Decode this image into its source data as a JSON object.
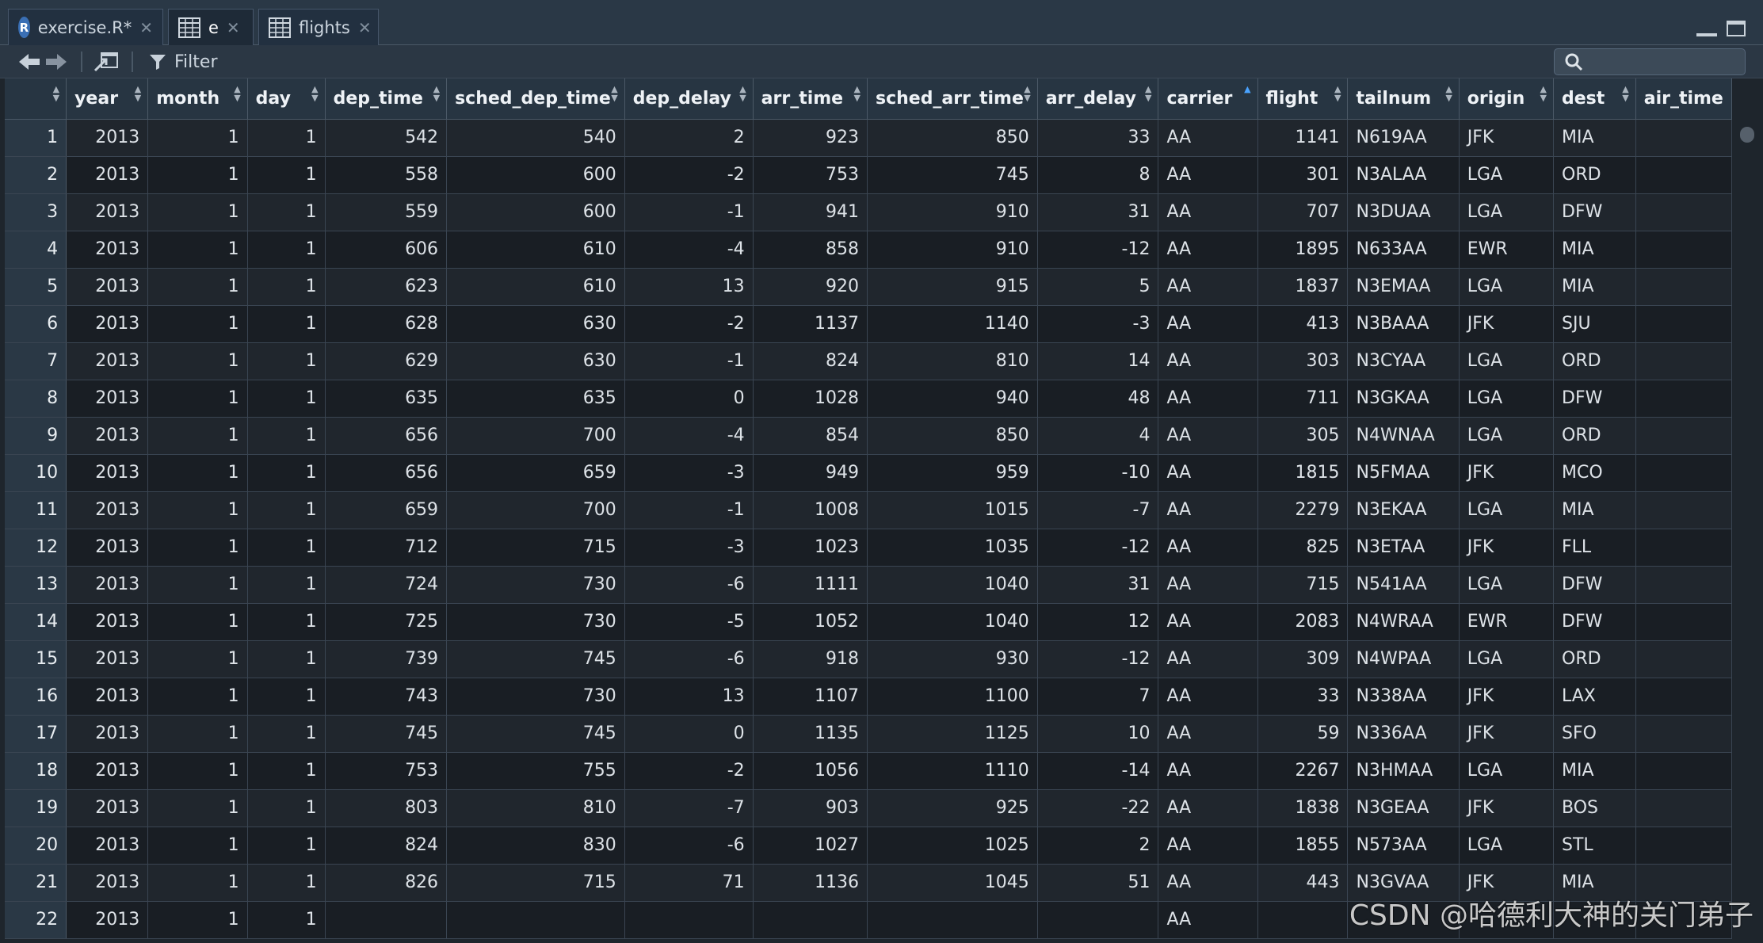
{
  "tabs": [
    {
      "label": "exercise.R*",
      "icon": "r-file-icon",
      "active": false
    },
    {
      "label": "e",
      "icon": "data-grid-icon",
      "active": true
    },
    {
      "label": "flights",
      "icon": "data-grid-icon",
      "active": false
    }
  ],
  "toolbar": {
    "filter_label": "Filter",
    "search_placeholder": ""
  },
  "columns": [
    {
      "label": "",
      "sort": "none"
    },
    {
      "label": "year",
      "sort": "none"
    },
    {
      "label": "month",
      "sort": "none"
    },
    {
      "label": "day",
      "sort": "none"
    },
    {
      "label": "dep_time",
      "sort": "none"
    },
    {
      "label": "sched_dep_time",
      "sort": "none"
    },
    {
      "label": "dep_delay",
      "sort": "none"
    },
    {
      "label": "arr_time",
      "sort": "none"
    },
    {
      "label": "sched_arr_time",
      "sort": "none"
    },
    {
      "label": "arr_delay",
      "sort": "none"
    },
    {
      "label": "carrier",
      "sort": "asc"
    },
    {
      "label": "flight",
      "sort": "none"
    },
    {
      "label": "tailnum",
      "sort": "none"
    },
    {
      "label": "origin",
      "sort": "none"
    },
    {
      "label": "dest",
      "sort": "none"
    },
    {
      "label": "air_time",
      "sort": "none"
    }
  ],
  "rows": [
    [
      "1",
      "2013",
      "1",
      "1",
      "542",
      "540",
      "2",
      "923",
      "850",
      "33",
      "AA",
      "1141",
      "N619AA",
      "JFK",
      "MIA",
      ""
    ],
    [
      "2",
      "2013",
      "1",
      "1",
      "558",
      "600",
      "-2",
      "753",
      "745",
      "8",
      "AA",
      "301",
      "N3ALAA",
      "LGA",
      "ORD",
      ""
    ],
    [
      "3",
      "2013",
      "1",
      "1",
      "559",
      "600",
      "-1",
      "941",
      "910",
      "31",
      "AA",
      "707",
      "N3DUAA",
      "LGA",
      "DFW",
      ""
    ],
    [
      "4",
      "2013",
      "1",
      "1",
      "606",
      "610",
      "-4",
      "858",
      "910",
      "-12",
      "AA",
      "1895",
      "N633AA",
      "EWR",
      "MIA",
      ""
    ],
    [
      "5",
      "2013",
      "1",
      "1",
      "623",
      "610",
      "13",
      "920",
      "915",
      "5",
      "AA",
      "1837",
      "N3EMAA",
      "LGA",
      "MIA",
      ""
    ],
    [
      "6",
      "2013",
      "1",
      "1",
      "628",
      "630",
      "-2",
      "1137",
      "1140",
      "-3",
      "AA",
      "413",
      "N3BAAA",
      "JFK",
      "SJU",
      ""
    ],
    [
      "7",
      "2013",
      "1",
      "1",
      "629",
      "630",
      "-1",
      "824",
      "810",
      "14",
      "AA",
      "303",
      "N3CYAA",
      "LGA",
      "ORD",
      ""
    ],
    [
      "8",
      "2013",
      "1",
      "1",
      "635",
      "635",
      "0",
      "1028",
      "940",
      "48",
      "AA",
      "711",
      "N3GKAA",
      "LGA",
      "DFW",
      ""
    ],
    [
      "9",
      "2013",
      "1",
      "1",
      "656",
      "700",
      "-4",
      "854",
      "850",
      "4",
      "AA",
      "305",
      "N4WNAA",
      "LGA",
      "ORD",
      ""
    ],
    [
      "10",
      "2013",
      "1",
      "1",
      "656",
      "659",
      "-3",
      "949",
      "959",
      "-10",
      "AA",
      "1815",
      "N5FMAA",
      "JFK",
      "MCO",
      ""
    ],
    [
      "11",
      "2013",
      "1",
      "1",
      "659",
      "700",
      "-1",
      "1008",
      "1015",
      "-7",
      "AA",
      "2279",
      "N3EKAA",
      "LGA",
      "MIA",
      ""
    ],
    [
      "12",
      "2013",
      "1",
      "1",
      "712",
      "715",
      "-3",
      "1023",
      "1035",
      "-12",
      "AA",
      "825",
      "N3ETAA",
      "JFK",
      "FLL",
      ""
    ],
    [
      "13",
      "2013",
      "1",
      "1",
      "724",
      "730",
      "-6",
      "1111",
      "1040",
      "31",
      "AA",
      "715",
      "N541AA",
      "LGA",
      "DFW",
      ""
    ],
    [
      "14",
      "2013",
      "1",
      "1",
      "725",
      "730",
      "-5",
      "1052",
      "1040",
      "12",
      "AA",
      "2083",
      "N4WRAA",
      "EWR",
      "DFW",
      ""
    ],
    [
      "15",
      "2013",
      "1",
      "1",
      "739",
      "745",
      "-6",
      "918",
      "930",
      "-12",
      "AA",
      "309",
      "N4WPAA",
      "LGA",
      "ORD",
      ""
    ],
    [
      "16",
      "2013",
      "1",
      "1",
      "743",
      "730",
      "13",
      "1107",
      "1100",
      "7",
      "AA",
      "33",
      "N338AA",
      "JFK",
      "LAX",
      ""
    ],
    [
      "17",
      "2013",
      "1",
      "1",
      "745",
      "745",
      "0",
      "1135",
      "1125",
      "10",
      "AA",
      "59",
      "N336AA",
      "JFK",
      "SFO",
      ""
    ],
    [
      "18",
      "2013",
      "1",
      "1",
      "753",
      "755",
      "-2",
      "1056",
      "1110",
      "-14",
      "AA",
      "2267",
      "N3HMAA",
      "LGA",
      "MIA",
      ""
    ],
    [
      "19",
      "2013",
      "1",
      "1",
      "803",
      "810",
      "-7",
      "903",
      "925",
      "-22",
      "AA",
      "1838",
      "N3GEAA",
      "JFK",
      "BOS",
      ""
    ],
    [
      "20",
      "2013",
      "1",
      "1",
      "824",
      "830",
      "-6",
      "1027",
      "1025",
      "2",
      "AA",
      "1855",
      "N573AA",
      "LGA",
      "STL",
      ""
    ],
    [
      "21",
      "2013",
      "1",
      "1",
      "826",
      "715",
      "71",
      "1136",
      "1045",
      "51",
      "AA",
      "443",
      "N3GVAA",
      "JFK",
      "MIA",
      ""
    ],
    [
      "22",
      "2013",
      "1",
      "1",
      "",
      "",
      "",
      "",
      "",
      "",
      "AA",
      "",
      "",
      "",
      "",
      ""
    ]
  ],
  "watermark": "CSDN @哈德利大神的关门弟子"
}
